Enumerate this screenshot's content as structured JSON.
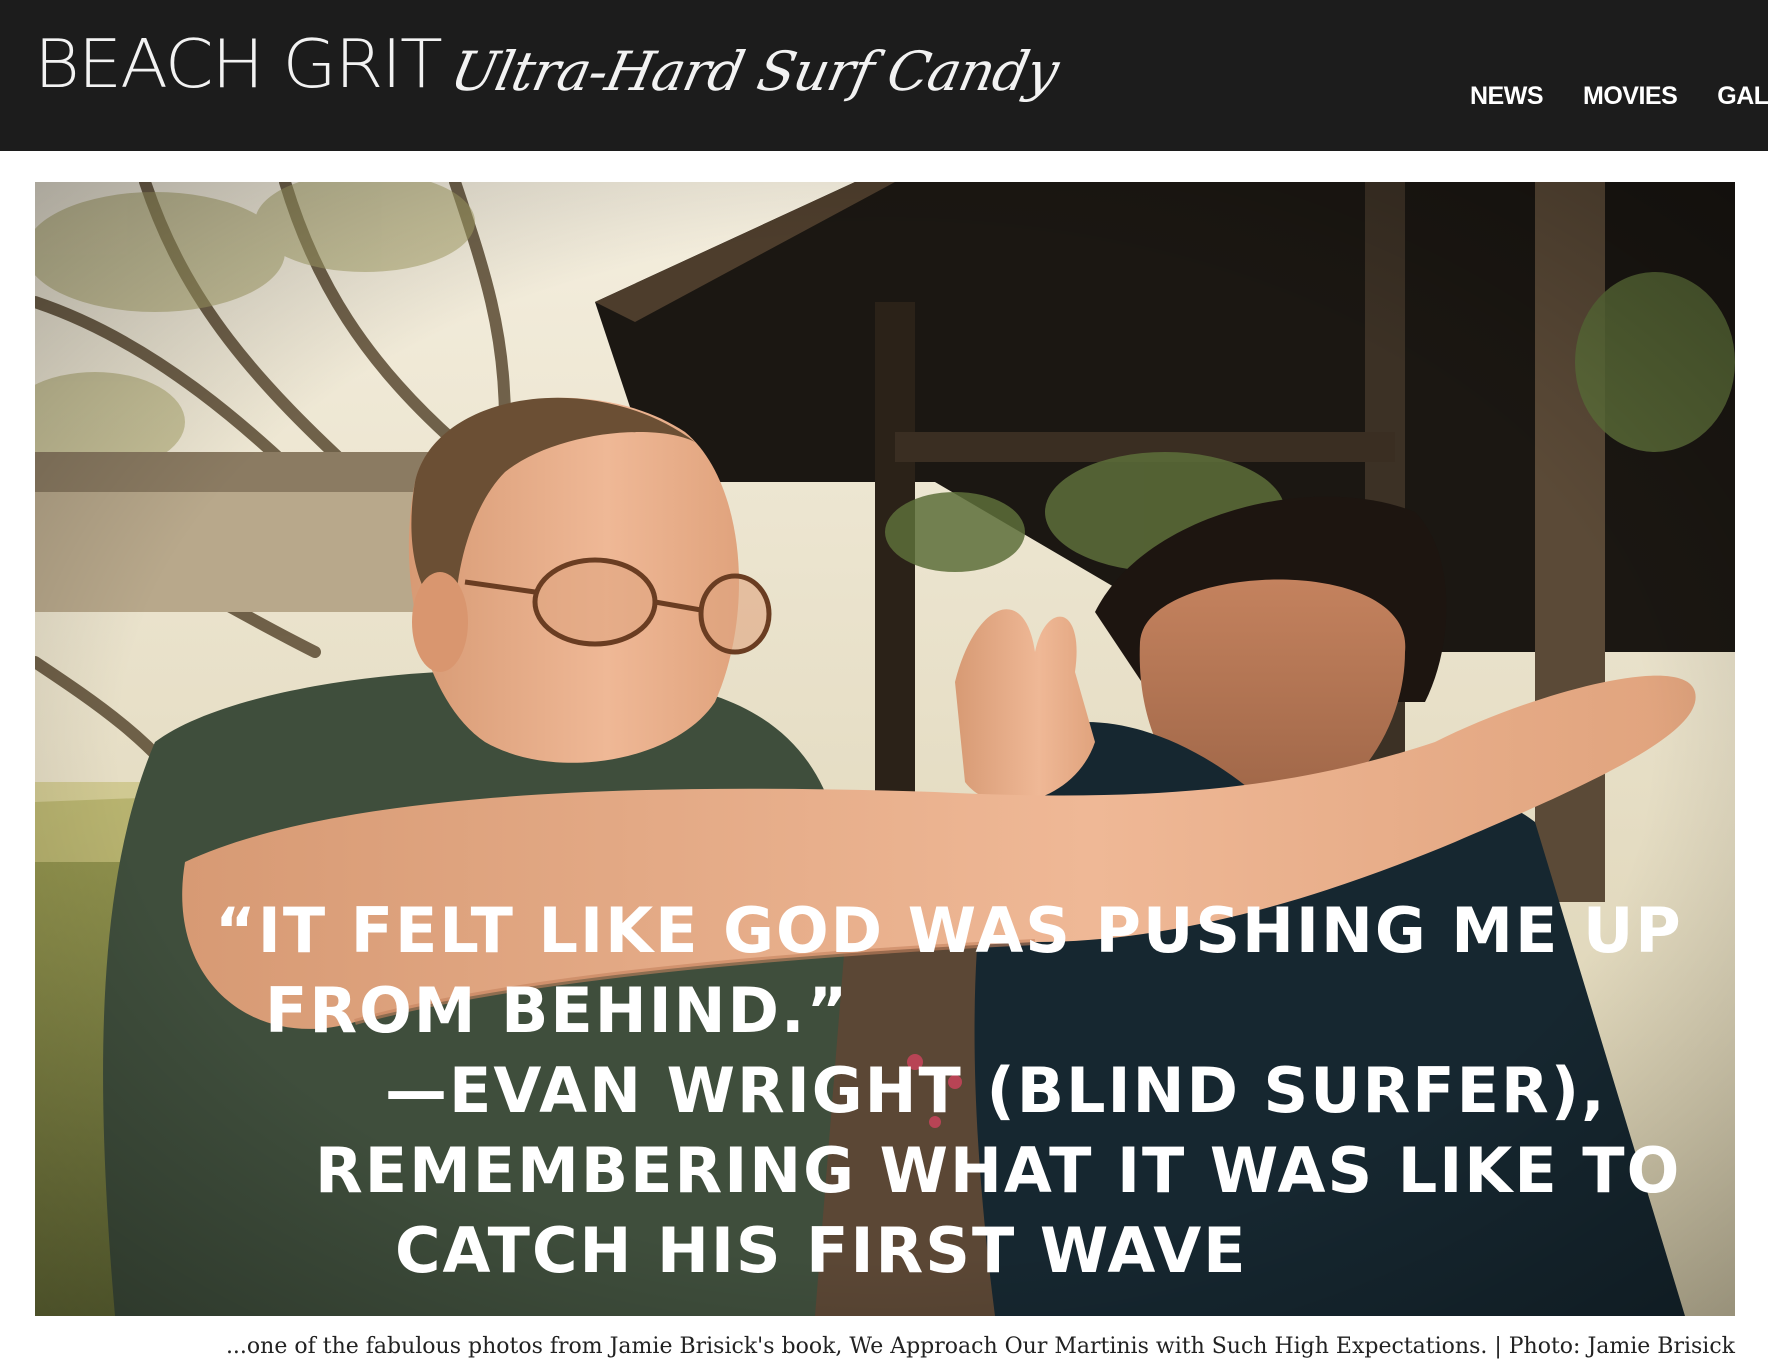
{
  "header": {
    "logo": "BEACH GRIT",
    "tagline": "Ultra-Hard Surf Candy"
  },
  "nav": {
    "items": [
      "NEWS",
      "MOVIES",
      "GALS"
    ]
  },
  "photo": {
    "quote_lines": [
      "“IT FELT LIKE GOD WAS PUSHING ME UP",
      "FROM BEHIND.”",
      "—EVAN WRIGHT (BLIND SURFER),",
      "REMEMBERING WHAT IT WAS LIKE TO",
      "CATCH HIS FIRST WAVE"
    ]
  },
  "caption": "...one of the fabulous photos from Jamie Brisick's book, We Approach Our Martinis with Such High Expectations. | Photo: Jamie Brisick",
  "colors": {
    "header_bg": "#1c1c1c",
    "nav_text": "#ffffff",
    "caption_text": "#222222"
  }
}
